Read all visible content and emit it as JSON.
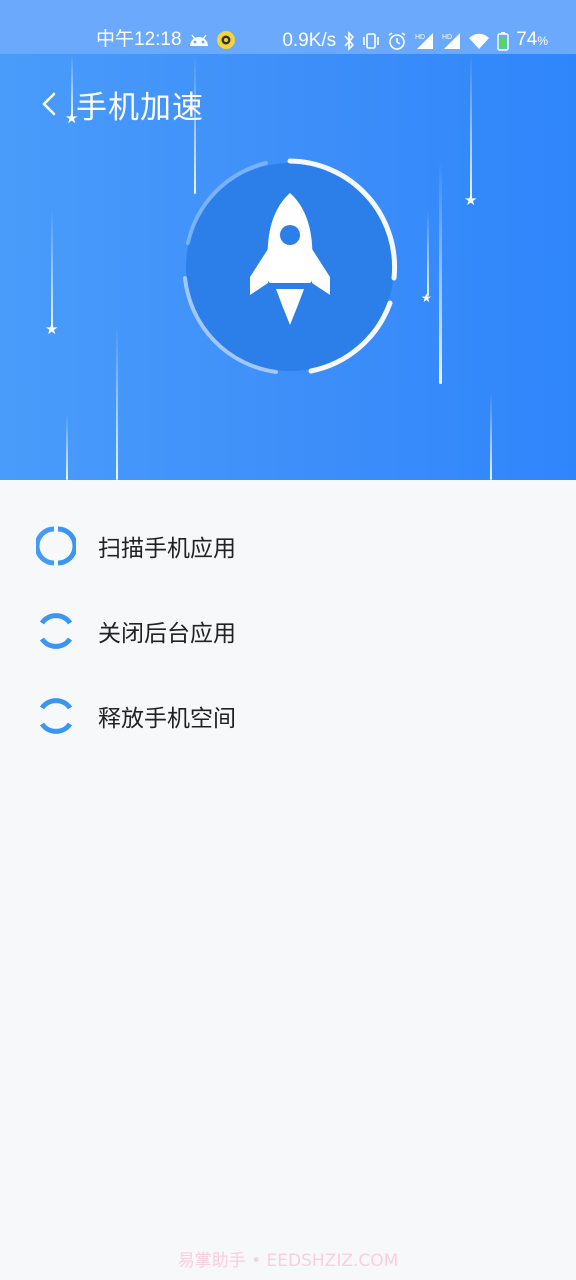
{
  "status_bar": {
    "time": "中午12:18",
    "network_speed": "0.9K/s",
    "battery_level": "74",
    "battery_unit": "%",
    "icons": [
      "android-icon",
      "record-icon",
      "bluetooth-icon",
      "vibrate-icon",
      "alarm-icon",
      "hd-signal-icon",
      "hd-signal-icon",
      "wifi-icon",
      "battery-icon"
    ]
  },
  "header": {
    "back_icon": "chevron-left-icon",
    "title": "手机加速"
  },
  "hero": {
    "icon": "rocket-icon",
    "progress_ring_color": "#ffffff",
    "background_color": "#3d8ef9"
  },
  "steps": [
    {
      "label": "扫描手机应用",
      "icon": "loading-spinner-icon"
    },
    {
      "label": "关闭后台应用",
      "icon": "loading-spinner-icon"
    },
    {
      "label": "释放手机空间",
      "icon": "loading-spinner-icon"
    }
  ],
  "watermark": "易掌助手 • EEDSHZIZ.COM",
  "colors": {
    "accent": "#3a96f0",
    "status_bar": "#6aa9fb",
    "page_background": "#f7f8fa"
  }
}
